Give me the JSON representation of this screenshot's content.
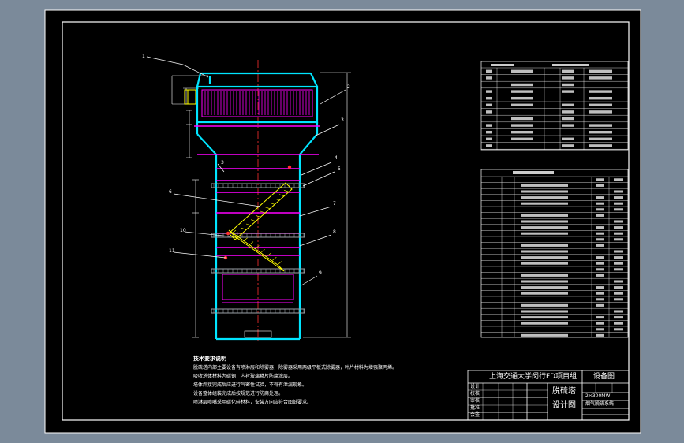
{
  "colors": {
    "viewport_bg": "#7b8a9a",
    "paper": "#000000",
    "frame": "#ffffff",
    "tower": "#00e5ff",
    "tray": "#ff00ff",
    "centerline": "#ff3030",
    "hatch": "#ffff00",
    "leader": "#ffffff"
  },
  "leaders": [
    "1",
    "2",
    "3",
    "4",
    "5",
    "6",
    "7",
    "8",
    "9",
    "10",
    "11",
    "3"
  ],
  "notes": {
    "heading": "技术要求说明",
    "lines": [
      "脱硫塔内部主要设备有喷淋层和除雾器，除雾器采用两级平板式除雾器，叶片材料为增强聚丙烯。",
      "吸收塔体材料为碳钢，内衬玻璃鳞片防腐涂层。",
      "塔体焊接完成后应进行气密性试验，不得有泄漏现象。",
      "设备整体组装完成后按规范进行防腐处理。",
      "喷淋层喷嘴采用碳化硅材料，安装方向应符合图纸要求。"
    ]
  },
  "title_block": {
    "school": "上海交通大学闵行FD项目组",
    "drawing_type": "设备图",
    "drawing_name_1": "脱硫塔",
    "drawing_name_2": "设计图",
    "part_1": "2×300MW",
    "part_2": "烟气脱硫系统",
    "roles": [
      "设计",
      "校核",
      "审核",
      "批准",
      "会签"
    ]
  }
}
